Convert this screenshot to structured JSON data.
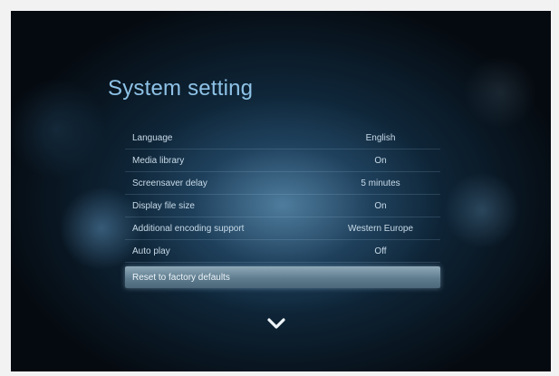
{
  "screen": {
    "title": "System setting"
  },
  "settings": [
    {
      "label": "Language",
      "value": "English"
    },
    {
      "label": "Media library",
      "value": "On"
    },
    {
      "label": "Screensaver delay",
      "value": "5 minutes"
    },
    {
      "label": "Display file size",
      "value": "On"
    },
    {
      "label": "Additional encoding support",
      "value": "Western Europe"
    },
    {
      "label": "Auto play",
      "value": "Off"
    }
  ],
  "selected_item": {
    "label": "Reset to factory defaults"
  },
  "navigation": {
    "scroll_down_icon": "chevron-down-icon"
  }
}
